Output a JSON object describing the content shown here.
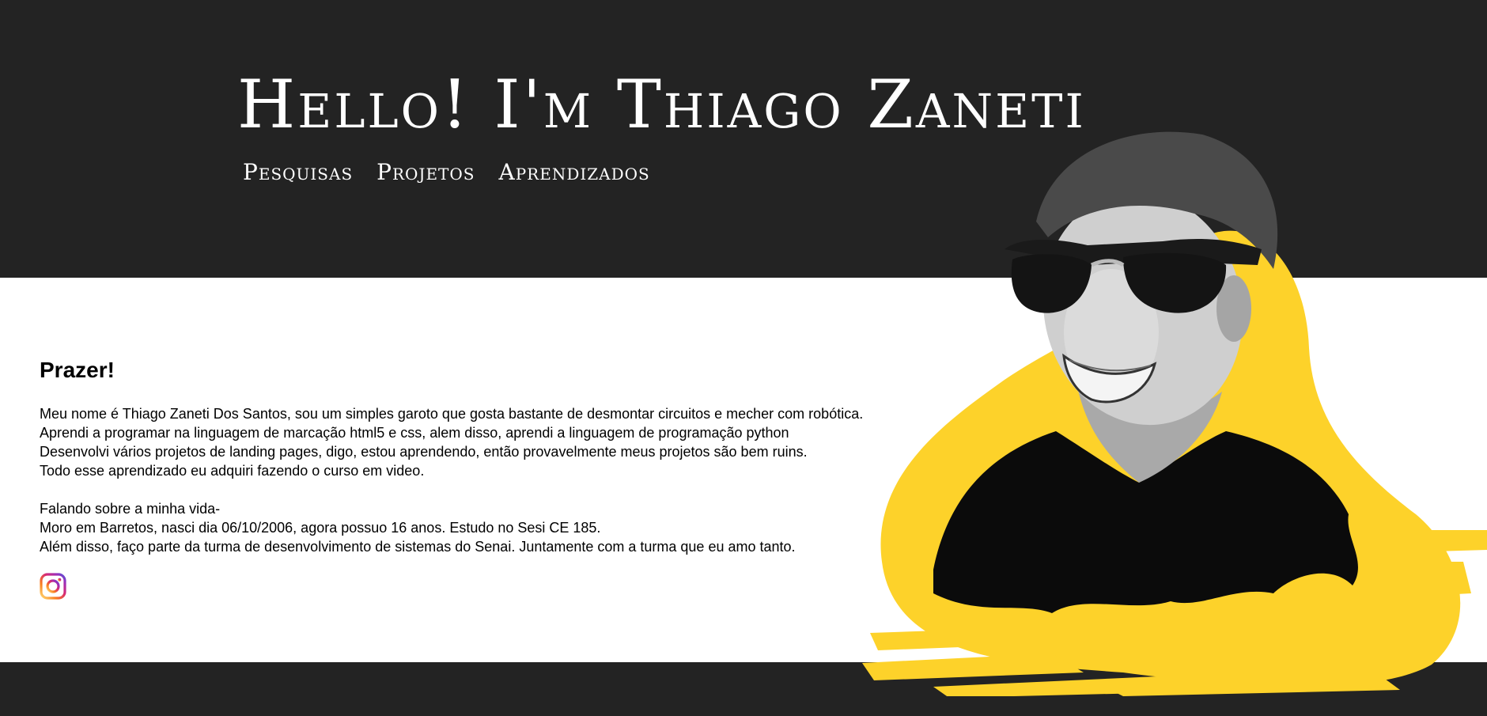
{
  "header": {
    "title": "Hello! I'm Thiago Zaneti",
    "nav": [
      {
        "label": "Pesquisas"
      },
      {
        "label": "Projetos"
      },
      {
        "label": "Aprendizados"
      }
    ]
  },
  "about": {
    "heading": "Prazer!",
    "paragraph1": [
      "Meu nome é Thiago Zaneti Dos Santos, sou um simples garoto que gosta bastante de desmontar circuitos e mecher com robótica.",
      "Aprendi a programar na linguagem de marcação html5 e css, alem disso, aprendi a linguagem de programação python",
      "Desenvolvi vários projetos de landing pages, digo, estou aprendendo, então provavelmente meus projetos são bem ruins.",
      "Todo esse aprendizado eu adquiri fazendo o curso em video."
    ],
    "paragraph2": [
      "Falando sobre a minha vida-",
      "Moro em Barretos, nasci dia 06/10/2006, agora possuo 16 anos. Estudo no Sesi CE 185.",
      "Além disso, faço parte da turma de desenvolvimento de sistemas do Senai. Juntamente com a turma que eu amo tanto."
    ]
  },
  "social": {
    "icon": "instagram-icon"
  },
  "colors": {
    "dark": "#232323",
    "accent_yellow": "#FDD22A",
    "text": "#000000",
    "white": "#FFFFFF"
  }
}
